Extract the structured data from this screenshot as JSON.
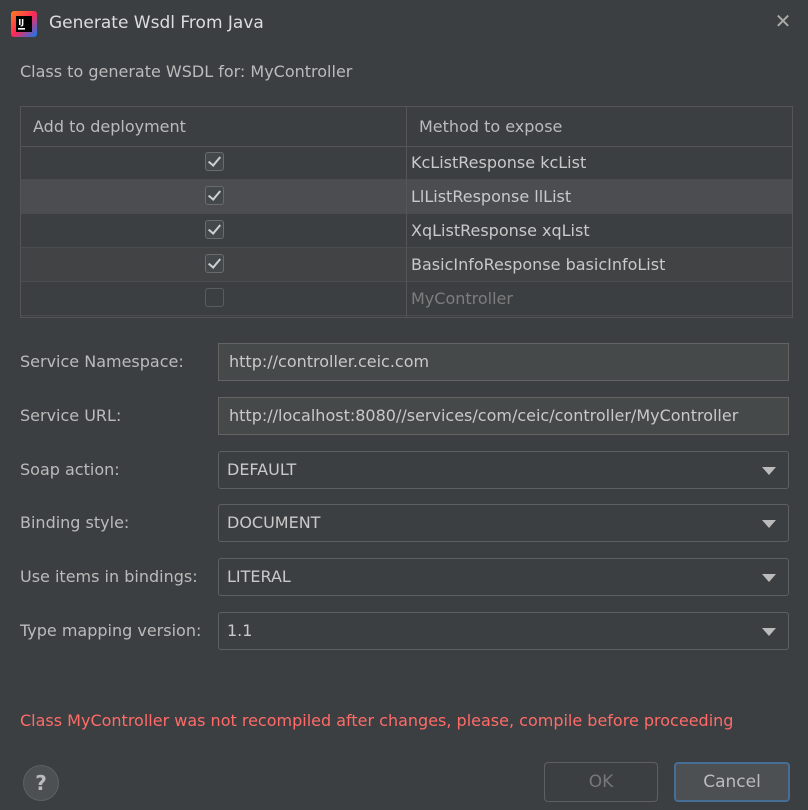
{
  "window": {
    "title": "Generate Wsdl From Java"
  },
  "class_label": "Class to generate WSDL for: MyController",
  "table": {
    "headers": [
      "Add to deployment",
      "Method to expose"
    ],
    "rows": [
      {
        "checked": true,
        "method": "KcListResponse kcList"
      },
      {
        "checked": true,
        "method": "LlListResponse llList"
      },
      {
        "checked": true,
        "method": "XqListResponse xqList"
      },
      {
        "checked": true,
        "method": "BasicInfoResponse basicInfoList"
      },
      {
        "checked": false,
        "method": "MyController"
      }
    ]
  },
  "form": {
    "namespace_label": "Service Namespace:",
    "namespace_value": "http://controller.ceic.com",
    "url_label": "Service URL:",
    "url_value": "http://localhost:8080//services/com/ceic/controller/MyController",
    "soap_label": "Soap action:",
    "soap_value": "DEFAULT",
    "binding_label": "Binding style:",
    "binding_value": "DOCUMENT",
    "items_label": "Use items in bindings:",
    "items_value": "LITERAL",
    "mapping_label": "Type mapping version:",
    "mapping_value": "1.1"
  },
  "error": "Class MyController was not recompiled after changes, please, compile before proceeding",
  "buttons": {
    "help": "?",
    "ok": "OK",
    "cancel": "Cancel"
  },
  "icons": {
    "app": "intellij-icon",
    "close": "close-icon",
    "dropdown": "chevron-down-icon",
    "check": "checkmark-icon"
  },
  "colors": {
    "background": "#3c3f41",
    "error": "#ff6b68",
    "focus": "#466d94"
  }
}
